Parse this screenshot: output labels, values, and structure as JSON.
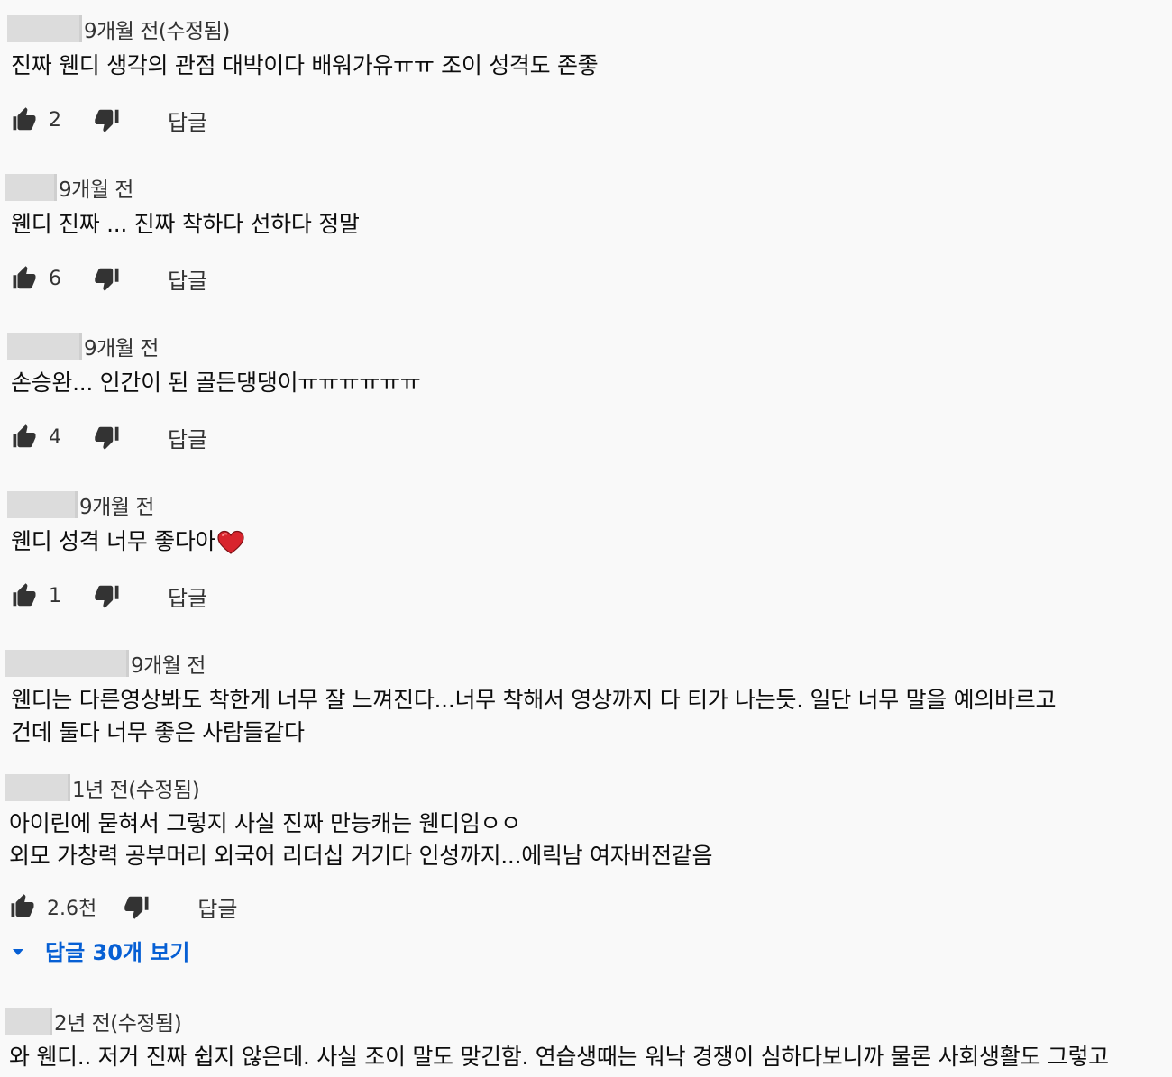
{
  "comments": [
    {
      "time": "9개월 전(수정됨)",
      "lines": [
        "진짜 웬디 생각의 관점 대박이다 배워가유ㅠㅠ 조이 성격도 존좋"
      ],
      "likes": "2",
      "reply": "답글"
    },
    {
      "time": "9개월 전",
      "lines": [
        "웬디 진짜 ... 진짜 착하다 선하다 정말"
      ],
      "likes": "6",
      "reply": "답글"
    },
    {
      "time": "9개월 전",
      "lines": [
        "손승완... 인간이 된 골든댕댕이ㅠㅠㅠㅠㅠㅠ"
      ],
      "likes": "4",
      "reply": "답글"
    },
    {
      "time": "9개월 전",
      "lines": [
        "웬디 성격 너무 좋다아"
      ],
      "likes": "1",
      "reply": "답글"
    },
    {
      "time": "9개월 전",
      "lines": [
        "웬디는 다른영상봐도 착한게 너무 잘 느껴진다...너무 착해서 영상까지 다 티가 나는듯. 일단 너무 말을 예의바르고",
        "건데 둘다 너무 좋은 사람들같다"
      ]
    },
    {
      "time": "1년 전(수정됨)",
      "lines": [
        "아이린에 묻혀서 그렇지 사실 진짜 만능캐는 웬디임ㅇㅇ",
        "외모 가창력 공부머리 외국어 리더십 거기다 인성까지...에릭남 여자버전같음"
      ],
      "likes": "2.6천",
      "reply": "답글",
      "more": "답글 30개 보기"
    },
    {
      "time": "2년 전(수정됨)",
      "lines": [
        "와 웬디.. 저거 진짜 쉽지 않은데. 사실 조이 말도 맞긴함. 연습생때는 워낙 경쟁이 심하다보니까 물론 사회생활도 그렇고"
      ]
    }
  ],
  "icons": {
    "like": "thumb-up-icon",
    "dislike": "thumb-down-icon",
    "expand": "caret-down-icon",
    "heart": "heart-emoji-icon"
  },
  "colors": {
    "link": "#065fd4",
    "background": "#f9f9f9",
    "redaction": "#dcdcdc"
  }
}
